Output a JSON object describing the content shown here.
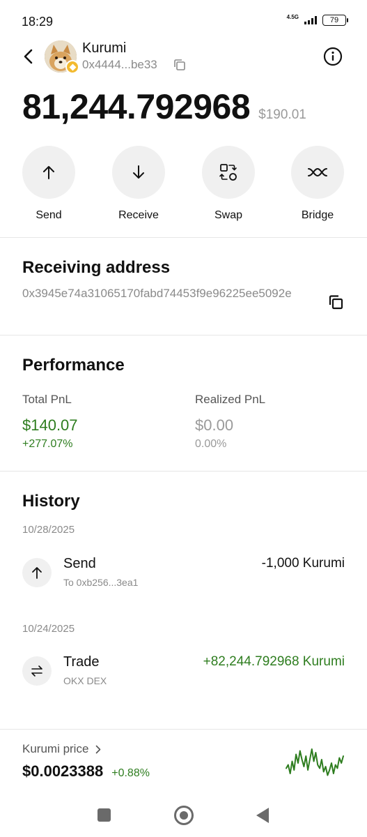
{
  "status_bar": {
    "time": "18:29",
    "network": "4.5G",
    "battery": "79"
  },
  "header": {
    "token_name": "Kurumi",
    "token_address_short": "0x4444...be33"
  },
  "balance": {
    "amount": "81,244.792968",
    "usd_value": "$190.01"
  },
  "actions": [
    {
      "label": "Send",
      "icon": "arrow-up-icon"
    },
    {
      "label": "Receive",
      "icon": "arrow-down-icon"
    },
    {
      "label": "Swap",
      "icon": "swap-icon"
    },
    {
      "label": "Bridge",
      "icon": "bridge-icon"
    }
  ],
  "receiving": {
    "title": "Receiving address",
    "address": "0x3945e74a31065170fabd74453f9e96225ee5092e"
  },
  "performance": {
    "title": "Performance",
    "total": {
      "label": "Total PnL",
      "value": "$140.07",
      "pct": "+277.07%"
    },
    "realized": {
      "label": "Realized PnL",
      "value": "$0.00",
      "pct": "0.00%"
    }
  },
  "history": {
    "title": "History",
    "groups": [
      {
        "date": "10/28/2025",
        "items": [
          {
            "title": "Send",
            "subtitle": "To 0xb256...3ea1",
            "amount": "-1,000 Kurumi",
            "icon": "arrow-up-icon"
          }
        ]
      },
      {
        "date": "10/24/2025",
        "items": [
          {
            "title": "Trade",
            "subtitle": "OKX DEX",
            "amount": "+82,244.792968 Kurumi",
            "icon": "trade-arrows-icon"
          }
        ]
      }
    ]
  },
  "price": {
    "label": "Kurumi price",
    "value": "$0.0023388",
    "change": "+0.88%",
    "sparkline": [
      0.35,
      0.45,
      0.2,
      0.55,
      0.3,
      0.75,
      0.5,
      0.85,
      0.6,
      0.4,
      0.7,
      0.3,
      0.6,
      0.9,
      0.55,
      0.8,
      0.45,
      0.35,
      0.6,
      0.25,
      0.4,
      0.15,
      0.3,
      0.5,
      0.2,
      0.45,
      0.35,
      0.65,
      0.5,
      0.7
    ]
  },
  "colors": {
    "positive": "#2e7d1f",
    "muted": "#8a8a8a",
    "action_bg": "#f0f0f0"
  }
}
